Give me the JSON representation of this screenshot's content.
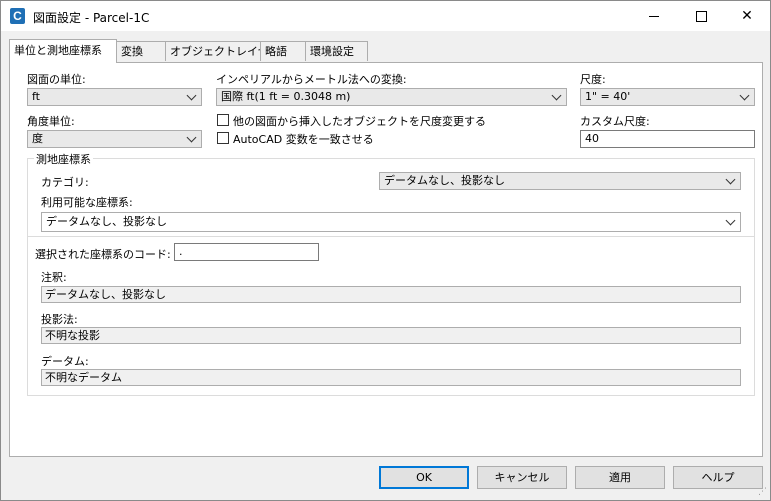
{
  "window": {
    "title": "図面設定 - Parcel-1C",
    "app_icon_letter": "C"
  },
  "tabs": [
    {
      "label": "単位と測地座標系",
      "active": true
    },
    {
      "label": "変換",
      "active": false
    },
    {
      "label": "オブジェクトレイヤ",
      "active": false
    },
    {
      "label": "略語",
      "active": false
    },
    {
      "label": "環境設定",
      "active": false
    }
  ],
  "units": {
    "drawing_units_label": "図面の単位:",
    "drawing_units_value": "ft",
    "imperial_label": "インペリアルからメートル法への変換:",
    "imperial_value": "国際 ft(1 ft = 0.3048 m)",
    "scale_label": "尺度:",
    "scale_value": "1\" = 40'",
    "angle_label": "角度単位:",
    "angle_value": "度",
    "scale_objects_label": "他の図面から挿入したオブジェクトを尺度変更する",
    "autocad_vars_label": "AutoCAD 変数を一致させる",
    "custom_scale_label": "カスタム尺度:",
    "custom_scale_value": "40"
  },
  "geo": {
    "group_label": "測地座標系",
    "category_label": "カテゴリ:",
    "category_value": "データムなし、投影なし",
    "available_label": "利用可能な座標系:",
    "available_value": "データムなし、投影なし",
    "selected_code_label": "選択された座標系のコード:",
    "selected_code_value": ".",
    "description_label": "注釈:",
    "description_value": "データムなし、投影なし",
    "projection_label": "投影法:",
    "projection_value": "不明な投影",
    "datum_label": "データム:",
    "datum_value": "不明なデータム"
  },
  "buttons": {
    "ok": "OK",
    "cancel": "キャンセル",
    "apply": "適用",
    "help": "ヘルプ"
  }
}
